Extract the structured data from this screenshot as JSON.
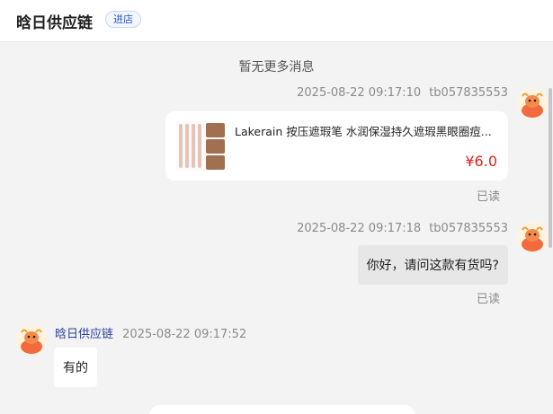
{
  "header": {
    "shop_name": "晗日供应链",
    "enter_label": "进店"
  },
  "notice": "暂无更多消息",
  "messages": [
    {
      "time": "2025-08-22 09:17:10",
      "user": "tb057835553",
      "product": {
        "title": "Lakerain 按压遮瑕笔 水润保湿持久遮瑕黑眼圈痘...",
        "price": "¥6.0"
      },
      "status": "已读"
    },
    {
      "time": "2025-08-22 09:17:18",
      "user": "tb057835553",
      "text": "你好，请问这款有货吗?",
      "status": "已读"
    },
    {
      "sender": "晗日供应链",
      "time": "2025-08-22 09:17:52",
      "text": "有的"
    }
  ],
  "colors": {
    "price": "#e02020",
    "seller_name": "#2a3f99",
    "enter_button": "#2a56c6"
  }
}
